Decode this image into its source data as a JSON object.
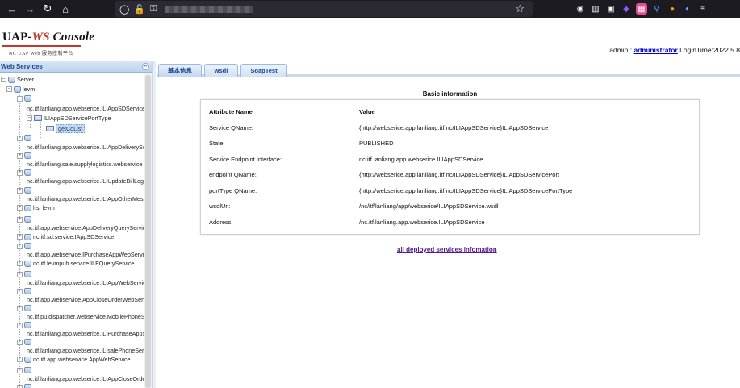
{
  "browser": {
    "back_icon": "←",
    "forward_icon": "→",
    "reload_icon": "↻",
    "home_icon": "⌂",
    "shield_icon": "◯",
    "lock_icon": "🔓",
    "key_icon": "⚿",
    "star_icon": "☆",
    "tools": [
      "◉",
      "▥",
      "▣",
      "◆",
      "▦",
      "⚲",
      "●",
      "◐",
      "≡"
    ]
  },
  "header": {
    "brand_prefix": "UAP-",
    "brand_ws": "WS",
    "brand_console": " Console",
    "brand_sub": "NC UAP    Web 服务控制平台",
    "user_prefix": "admin : ",
    "user_name": "administrator",
    "login_time": " LoginTime:2022.5.8"
  },
  "sidebar": {
    "title": "Web Services",
    "collapse_glyph": "«",
    "tree": [
      {
        "label": "Server"
      },
      {
        "label": "levm"
      },
      {
        "label": ""
      },
      {
        "label": "nc.itf.lanliang.app.webserice.ILIAppSDService"
      },
      {
        "label": "ILIAppSDServicePortType"
      },
      {
        "label": "getCoList"
      },
      {
        "label": ""
      },
      {
        "label": "nc.itf.lanliang.app.webserice.ILIAppDeliveryService"
      },
      {
        "label": ""
      },
      {
        "label": "nc.itf.lanliang.sale.supplylogistics.webservice"
      },
      {
        "label": ""
      },
      {
        "label": "nc.itf.lanliang.app.webserice.ILIUpdateBillLogService"
      },
      {
        "label": ""
      },
      {
        "label": "nc.itf.lanliang.app.webserice.ILIAppOtherMessage"
      },
      {
        "label": "hs_levm"
      },
      {
        "label": ""
      },
      {
        "label": "nc.itf.app.webservice.AppDeliveryQueryService"
      },
      {
        "label": "nc.itf.sd.service.IAppSDService"
      },
      {
        "label": ""
      },
      {
        "label": "nc.itf.app.webservice.IPurchaseAppWebService"
      },
      {
        "label": "nc.itf.levmpub.service.ILEQueryService"
      },
      {
        "label": ""
      },
      {
        "label": "nc.itf.lanliang.app.webserice.ILIAppWebService"
      },
      {
        "label": ""
      },
      {
        "label": "nc.itf.app.webservice.AppCloseOrderWebService"
      },
      {
        "label": ""
      },
      {
        "label": "nc.itf.pu.dispatcher.webservice.MobilePhoneService"
      },
      {
        "label": ""
      },
      {
        "label": "nc.itf.lanliang.app.webserice.ILIPurchaseAppService"
      },
      {
        "label": ""
      },
      {
        "label": "nc.itf.lanliang.app.webserice.ILIsalePhoneService"
      },
      {
        "label": "nc.itf.app.webservice.AppWebService"
      },
      {
        "label": ""
      },
      {
        "label": "nc.itf.lanliang.app.webserice.ILIAppCloseOrder"
      },
      {
        "label": ""
      }
    ]
  },
  "tabs": [
    {
      "label": "基本信息"
    },
    {
      "label": "wsdl"
    },
    {
      "label": "SoapTest"
    }
  ],
  "basic_info": {
    "title": "Basic information",
    "header": {
      "name": "Attribute Name",
      "value": "Value"
    },
    "rows": [
      {
        "name": "Service QName:",
        "value": "{http://webserice.app.lanliang.itf.nc/ILIAppSDService}ILIAppSDService"
      },
      {
        "name": "State:",
        "value": "PUBLISHED"
      },
      {
        "name": "Service Endpoint Interface:",
        "value": "nc.itf.lanliang.app.webserice.ILIAppSDService"
      },
      {
        "name": "endpoint QName:",
        "value": "{http://webserice.app.lanliang.itf.nc/ILIAppSDService}ILIAppSDServicePort"
      },
      {
        "name": "portType QName:",
        "value": "{http://webserice.app.lanliang.itf.nc/ILIAppSDService}ILIAppSDServicePortType"
      },
      {
        "name": "wsdlUri:",
        "value": "/nc/itf/lanliang/app/webserice/ILIAppSDService.wsdl"
      },
      {
        "name": "Address:",
        "value": "/nc.itf.lanliang.app.webserice.ILIAppSDService"
      }
    ]
  },
  "all_services_link": "all deployed services infomation"
}
